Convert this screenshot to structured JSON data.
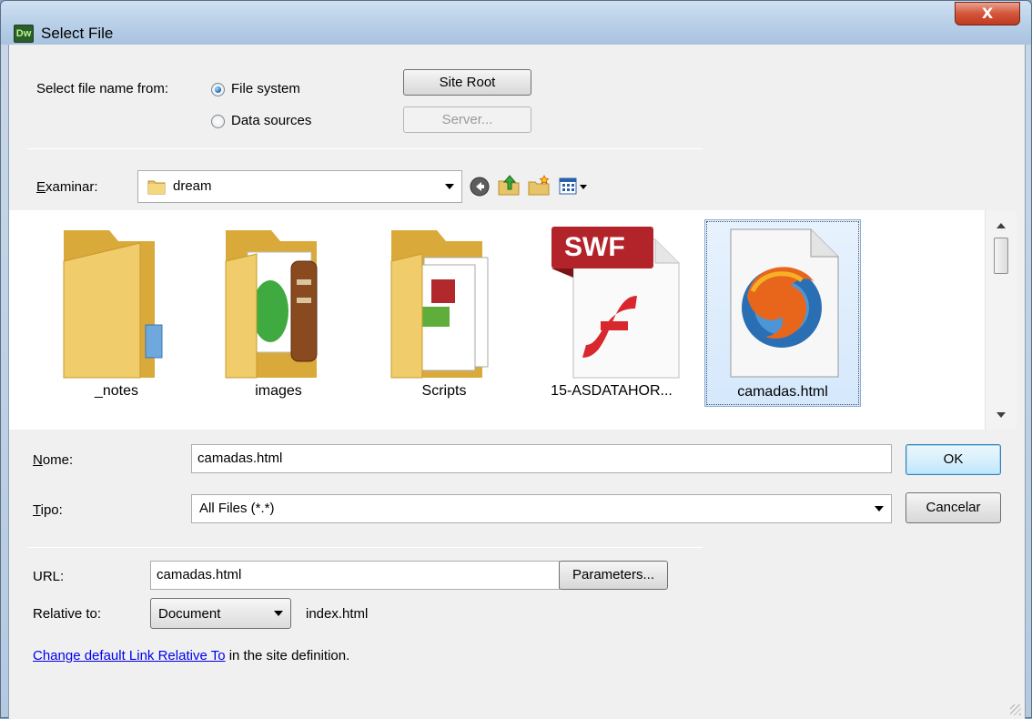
{
  "window": {
    "app_badge": "Dw",
    "title": "Select File",
    "close_glyph": "X"
  },
  "source": {
    "label": "Select file name from:",
    "options": [
      "File system",
      "Data sources"
    ],
    "selected": "File system",
    "site_root_button": "Site Root",
    "server_button": "Server..."
  },
  "browse": {
    "label": "Examinar:",
    "folder": "dream",
    "toolbar_icons": [
      "back-icon",
      "up-folder-icon",
      "new-folder-icon",
      "view-menu-icon"
    ]
  },
  "files": [
    {
      "name": "_notes",
      "icon": "folder-icon"
    },
    {
      "name": "images",
      "icon": "folder-images-icon"
    },
    {
      "name": "Scripts",
      "icon": "folder-scripts-icon"
    },
    {
      "name": "15-ASDATAHOR...",
      "icon": "swf-file-icon",
      "badge": "SWF"
    },
    {
      "name": "camadas.html",
      "icon": "firefox-html-icon",
      "selected": true
    }
  ],
  "form": {
    "name_label": "Nome:",
    "name_value": "camadas.html",
    "type_label": "Tipo:",
    "type_value": "All Files (*.*)",
    "ok_button": "OK",
    "cancel_button": "Cancelar"
  },
  "url": {
    "label": "URL:",
    "value": "camadas.html",
    "parameters_button": "Parameters...",
    "relative_label": "Relative to:",
    "relative_value": "Document",
    "relative_file": "index.html",
    "hint_link": "Change default Link Relative To",
    "hint_text": " in the site definition."
  },
  "colors": {
    "accent_blue": "#1b66b8",
    "selection": "#d5e8fc",
    "link": "#0000ee",
    "close_red": "#c13a1f"
  }
}
